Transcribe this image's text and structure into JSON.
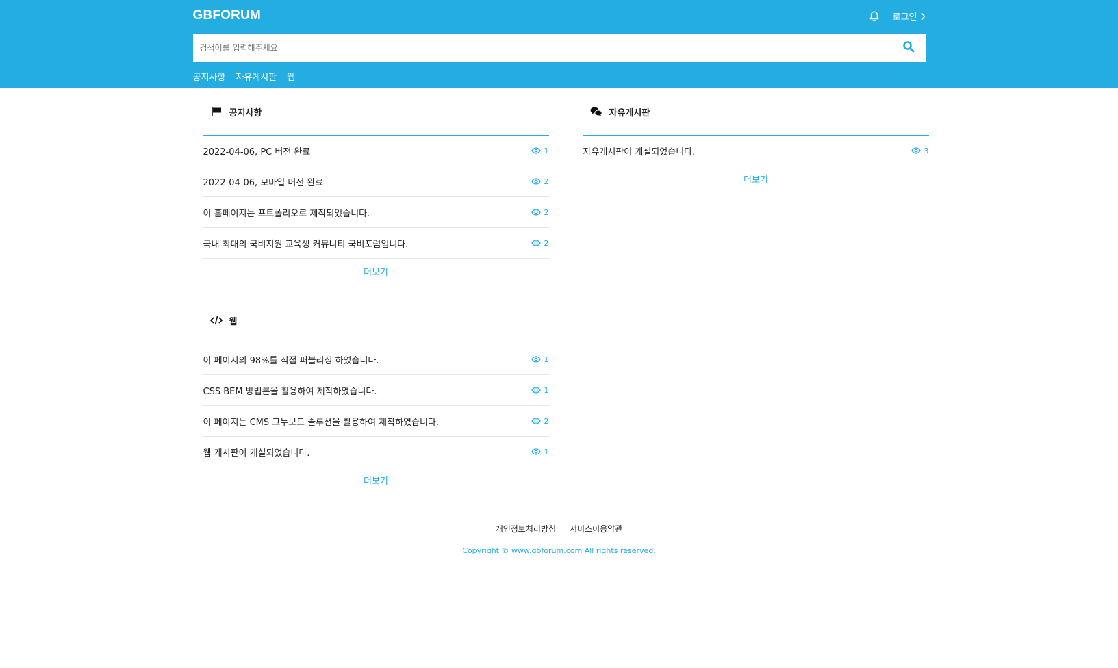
{
  "header": {
    "logo": "GBFORUM",
    "login_label": "로그인",
    "search_placeholder": "검색어를 입력해주세요",
    "nav": [
      "공지사항",
      "자유게시판",
      "웹"
    ]
  },
  "boards": {
    "notice": {
      "title": "공지사항",
      "icon": "flag-icon",
      "posts": [
        {
          "title": "2022-04-06, PC 버전 완료",
          "views": "1"
        },
        {
          "title": "2022-04-06, 모바일 버전 완료",
          "views": "2"
        },
        {
          "title": "이 홈페이지는 포트폴리오로 제작되었습니다.",
          "views": "2"
        },
        {
          "title": "국내 최대의 국비지원 교육생 커뮤니티 국비포럼입니다.",
          "views": "2"
        }
      ],
      "more": "더보기"
    },
    "free": {
      "title": "자유게시판",
      "icon": "comments-icon",
      "posts": [
        {
          "title": "자유게시판이 개설되었습니다.",
          "views": "3"
        }
      ],
      "more": "더보기"
    },
    "web": {
      "title": "웹",
      "icon": "code-icon",
      "posts": [
        {
          "title": "이 페이지의 98%를 직접 퍼블리싱 하였습니다.",
          "views": "1"
        },
        {
          "title": "CSS BEM 방법론을 활용하여 제작하였습니다.",
          "views": "1"
        },
        {
          "title": "이 페이지는 CMS 그누보드 솔루션을 활용하여 제작하였습니다.",
          "views": "2"
        },
        {
          "title": "웹 게시판이 개설되었습니다.",
          "views": "1"
        }
      ],
      "more": "더보기"
    }
  },
  "footer": {
    "links": [
      "개인정보처리방침",
      "서비스이용약관"
    ],
    "copyright": "Copyright © www.gbforum.com All rights reserved."
  },
  "colors": {
    "accent": "#23ade0",
    "divider": "#e6e6e6"
  }
}
